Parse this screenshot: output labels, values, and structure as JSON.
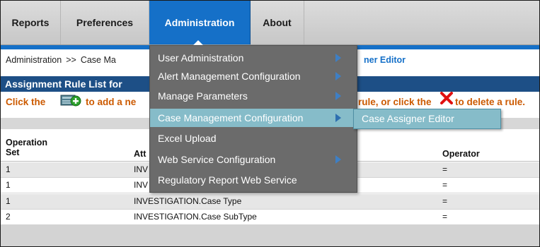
{
  "nav": {
    "tabs": [
      {
        "label": "Reports"
      },
      {
        "label": "Preferences"
      },
      {
        "label": "Administration"
      },
      {
        "label": "About"
      }
    ]
  },
  "breadcrumb": {
    "root": "Administration",
    "separator": ">>",
    "current": "Case Ma",
    "right_text": "ner Editor"
  },
  "title": "Assignment Rule List for",
  "instructions": {
    "prefix": "Click the",
    "middle": "to add a ne",
    "right_a": "rule, or click the",
    "right_b": "to delete a rule."
  },
  "table": {
    "headers": {
      "operation_set_1": "Operation",
      "operation_set_2": "Set",
      "attribute": "Att",
      "operator": "Operator"
    },
    "rows": [
      {
        "set": "1",
        "attribute": "INV",
        "operator": "="
      },
      {
        "set": "1",
        "attribute": "INV",
        "operator": "="
      },
      {
        "set": "1",
        "attribute": "INVESTIGATION.Case Type",
        "operator": "="
      },
      {
        "set": "2",
        "attribute": "INVESTIGATION.Case SubType",
        "operator": "="
      }
    ]
  },
  "menu": {
    "items": [
      {
        "label": "User Administration",
        "has_submenu": true
      },
      {
        "label": "Alert Management Configuration",
        "has_submenu": true
      },
      {
        "label": "Manage Parameters",
        "has_submenu": true
      },
      {
        "label": "Case Management Configuration",
        "has_submenu": true
      },
      {
        "label": "Excel Upload",
        "has_submenu": false
      },
      {
        "label": "Web Service Configuration",
        "has_submenu": true
      },
      {
        "label": "Regulatory Report Web Service",
        "has_submenu": false
      }
    ],
    "highlighted_index": 3,
    "submenu": {
      "items": [
        {
          "label": "Case Assigner Editor"
        }
      ]
    }
  },
  "colors": {
    "nav_active": "#1570c8",
    "title_bar": "#1d4f86",
    "instruction_text": "#cc5a00",
    "menu_bg": "#6b6b6b",
    "menu_highlight": "#86bcc9"
  }
}
